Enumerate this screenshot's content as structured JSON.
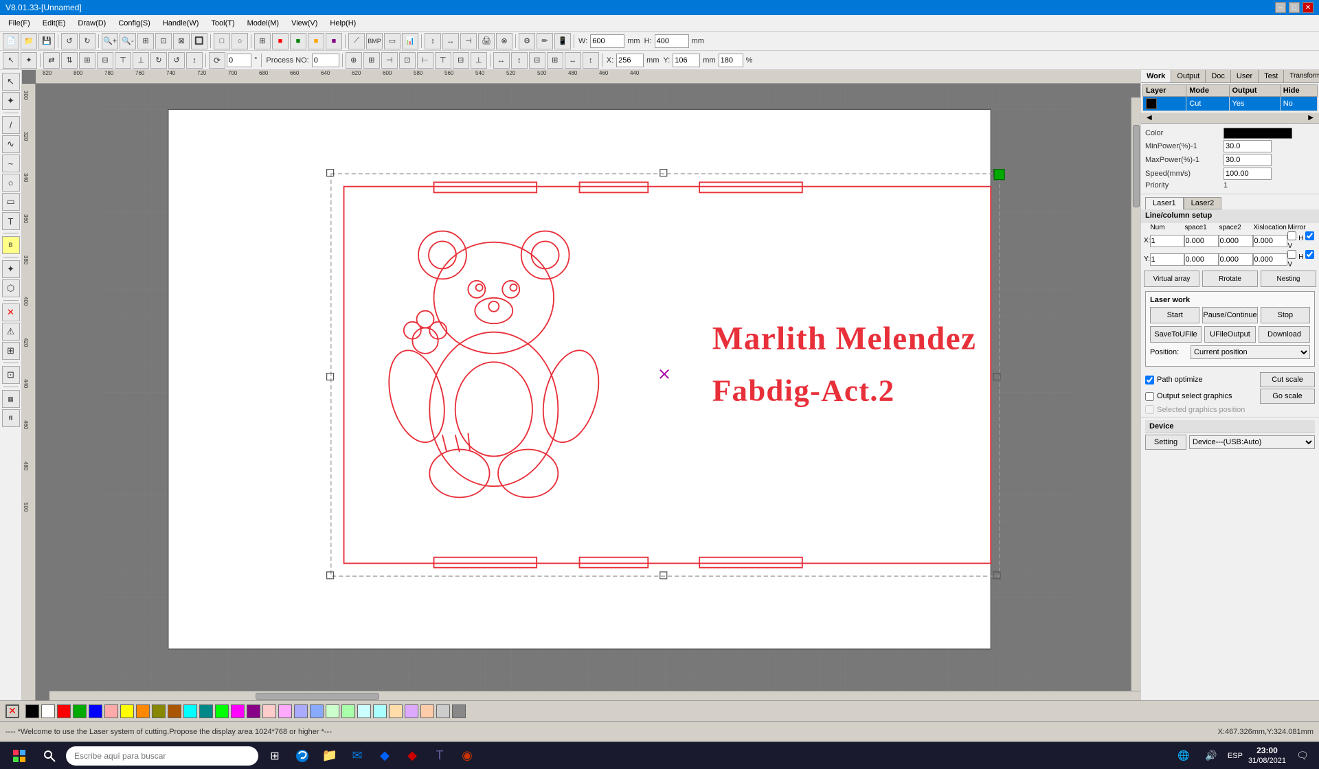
{
  "titlebar": {
    "title": "V8.01.33-[Unnamed]",
    "min": "–",
    "max": "□",
    "close": "✕"
  },
  "menubar": {
    "items": [
      {
        "label": "File(F)"
      },
      {
        "label": "Edit(E)"
      },
      {
        "label": "Draw(D)"
      },
      {
        "label": "Config(S)"
      },
      {
        "label": "Handle(W)"
      },
      {
        "label": "Tool(T)"
      },
      {
        "label": "Model(M)"
      },
      {
        "label": "View(V)"
      },
      {
        "label": "Help(H)"
      }
    ]
  },
  "toolbar1": {
    "width_label": "mm",
    "height_label": "mm",
    "width_value": "600",
    "height_value": "400",
    "width2_value": "256",
    "height2_value": "106",
    "pct_value": "180"
  },
  "toolbar2": {
    "rotation": "0",
    "process_no_label": "Process NO:",
    "process_no": "0"
  },
  "right_panel": {
    "tabs": [
      {
        "label": "Work",
        "active": true
      },
      {
        "label": "Output"
      },
      {
        "label": "Doc"
      },
      {
        "label": "User"
      },
      {
        "label": "Test"
      },
      {
        "label": "Transform"
      }
    ],
    "layer_table": {
      "headers": [
        "Layer",
        "Mode",
        "Output",
        "Hide"
      ],
      "rows": [
        {
          "layer": "",
          "mode": "Cut",
          "output": "Yes",
          "hide": "No",
          "active": true
        }
      ]
    },
    "panel_scroll": {
      "left": "◀",
      "right": "▶"
    },
    "color_label": "Color",
    "min_power_label": "MinPower(%)-1",
    "min_power": "30.0",
    "max_power_label": "MaxPower(%)-1",
    "max_power": "30.0",
    "speed_label": "Speed(mm/s)",
    "speed": "100.00",
    "priority_label": "Priority",
    "priority": "1",
    "laser_tabs": [
      "Laser1",
      "Laser2"
    ],
    "line_column_title": "Line/column setup",
    "lcs_headers": [
      "Num",
      "space1",
      "space2",
      "Xislocation",
      "Mirror"
    ],
    "lcs_x": {
      "num": "1",
      "space1": "0.000",
      "space2": "0.000",
      "xloc": "0.000",
      "hcheck": "H",
      "vcheck": "V"
    },
    "lcs_y": {
      "num": "1",
      "space1": "0.000",
      "space2": "0.000",
      "xloc": "0.000",
      "hcheck": "H",
      "vcheck": "V"
    },
    "virtual_array_btn": "Virtual array",
    "rrotate_btn": "Rrotate",
    "nesting_btn": "Nesting",
    "laser_work_title": "Laser work",
    "start_btn": "Start",
    "pause_btn": "Pause/Continue",
    "stop_btn": "Stop",
    "save_file_btn": "SaveToUFile",
    "ufile_btn": "UFileOutput",
    "download_btn": "Download",
    "position_label": "Position:",
    "position_value": "Current position",
    "path_optimize": "Path optimize",
    "output_select_graphics": "Output select graphics",
    "selected_graphics_pos": "Selected graphics position",
    "cut_scale_btn": "Cut scale",
    "go_scale_btn": "Go scale",
    "device_title": "Device",
    "setting_btn": "Setting",
    "device_value": "Device---(USB:Auto)"
  },
  "statusbar": {
    "message": "---- *Welcome to use the Laser system of cutting.Propose the display area 1024*768 or higher *---",
    "coords": "X:467.326mm,Y:324.081mm"
  },
  "colorbar": {
    "colors": [
      "#000000",
      "#ffffff",
      "#ff0000",
      "#00aa00",
      "#0000ff",
      "#ffaaaa",
      "#ffff00",
      "#ff8800",
      "#888800",
      "#aa5500",
      "#00ffff",
      "#008888",
      "#00ff00",
      "#ff00ff",
      "#880088",
      "#ffcccc",
      "#ffaaff",
      "#aaaaff",
      "#88aaff",
      "#ccffcc",
      "#aaffaa",
      "#ccffff",
      "#aaffff",
      "#ffddaa",
      "#ddaaff",
      "#ffccaa",
      "#cccccc",
      "#888888"
    ]
  },
  "taskbar": {
    "search_placeholder": "Escribe aquí para buscar",
    "clock_time": "23:00",
    "clock_date": "31/08/2021",
    "lang": "ESP"
  },
  "canvas": {
    "design_title1": "Marlith Melendez",
    "design_title2": "Fabdig-Act.2"
  },
  "rulers": {
    "top_values": [
      "820",
      "800",
      "780",
      "760",
      "740",
      "720",
      "700",
      "680",
      "660",
      "640",
      "620",
      "600",
      "580",
      "560",
      "540",
      "520",
      "500",
      "480",
      "460",
      "440"
    ],
    "left_values": [
      "300",
      "320",
      "340",
      "360",
      "380",
      "400",
      "420",
      "440",
      "460",
      "480",
      "500"
    ]
  }
}
